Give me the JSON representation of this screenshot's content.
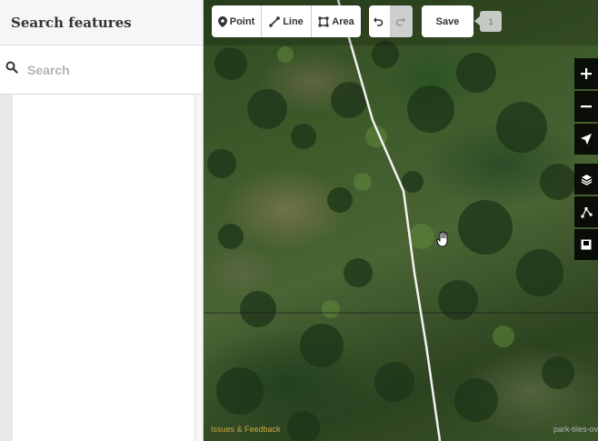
{
  "sidebar": {
    "title": "Search features",
    "search": {
      "placeholder": "Search",
      "value": ""
    }
  },
  "toolbar": {
    "point_label": "Point",
    "line_label": "Line",
    "area_label": "Area",
    "save_label": "Save",
    "edit_count": "1"
  },
  "map": {
    "attribution": "Issues & Feedback",
    "tile_label": "park-tiles-ov"
  },
  "colors": {
    "accent": "#ffffff",
    "sidebar_bg": "#f6f6f6",
    "control_bg": "#000000",
    "attribution": "#c9a642"
  },
  "icons": [
    "search-icon",
    "point-icon",
    "line-icon",
    "area-icon",
    "undo-icon",
    "redo-icon",
    "zoom-in-icon",
    "zoom-out-icon",
    "geolocate-icon",
    "layers-icon",
    "map-data-icon",
    "help-icon",
    "hand-cursor-icon"
  ]
}
